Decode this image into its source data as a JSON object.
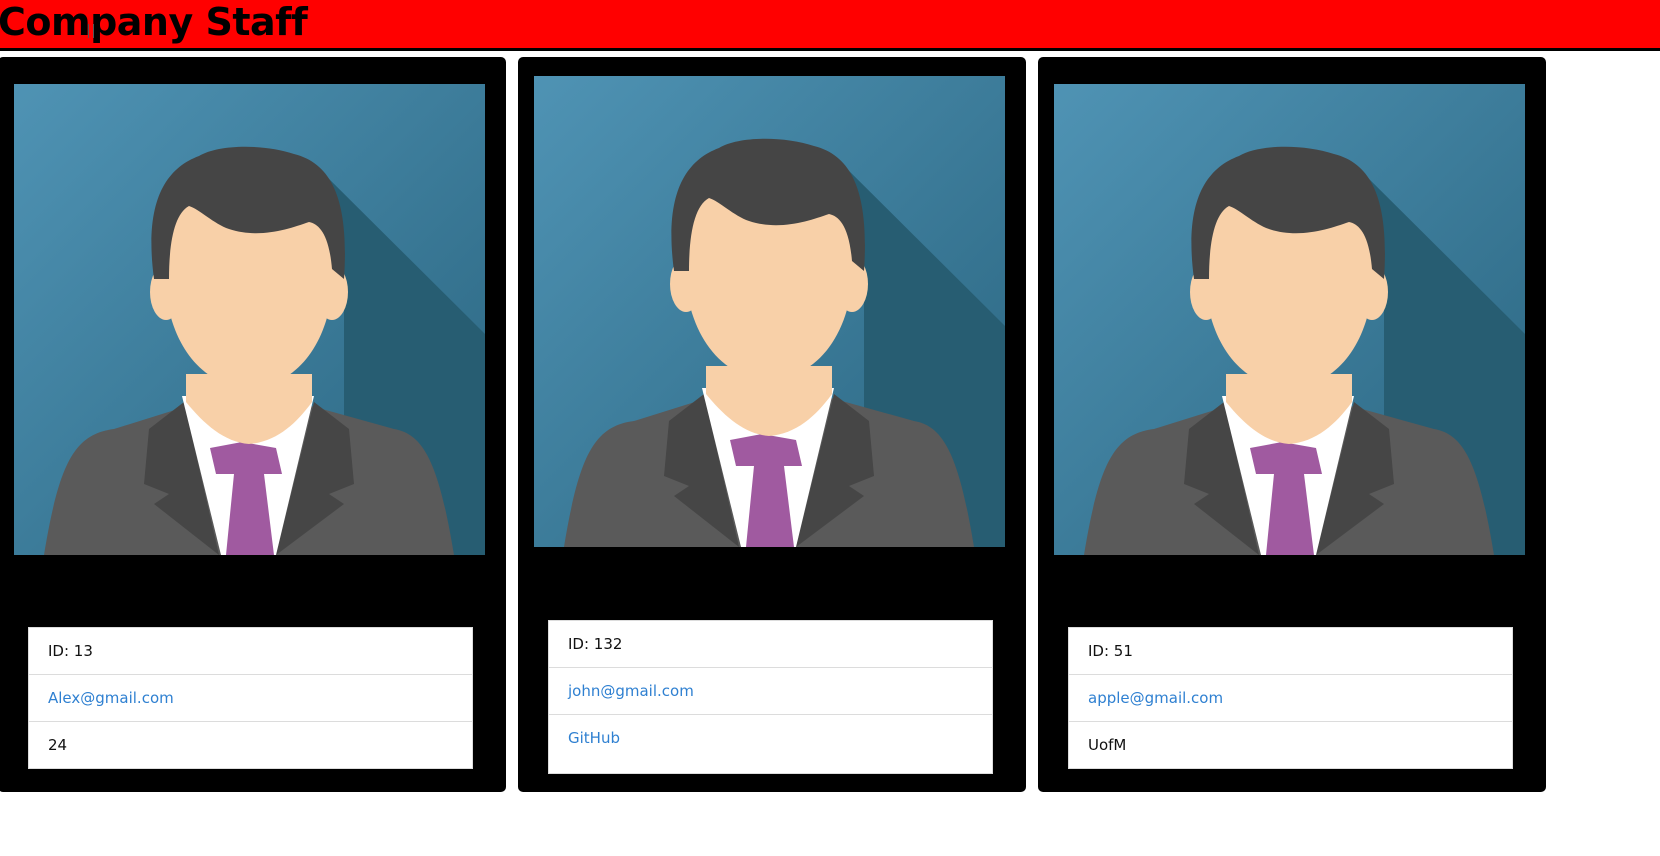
{
  "header": {
    "title": "Company Staff"
  },
  "colors": {
    "header_bg": "#ff0000",
    "card_bg": "#000000",
    "link": "#2f80d1"
  },
  "cards": [
    {
      "id_text": "ID: 13",
      "email": "Alex@gmail.com",
      "extra": "24",
      "extra_is_link": false
    },
    {
      "id_text": "ID: 132",
      "email": "john@gmail.com",
      "extra": "GitHub",
      "extra_is_link": true
    },
    {
      "id_text": "ID: 51",
      "email": "apple@gmail.com",
      "extra": "UofM",
      "extra_is_link": false
    }
  ]
}
